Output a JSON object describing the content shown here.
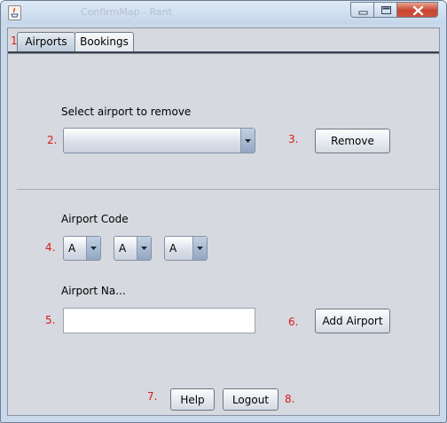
{
  "window": {
    "blurred_title": "ConfirmMap - Rant",
    "controls": [
      "minimize-icon",
      "maximize-icon",
      "close-icon"
    ]
  },
  "tabs": [
    {
      "label": "Airports",
      "selected": true
    },
    {
      "label": "Bookings",
      "selected": false
    }
  ],
  "annotations": {
    "n1": "1.",
    "n2": "2.",
    "n3": "3.",
    "n4": "4.",
    "n5": "5.",
    "n6": "6.",
    "n7": "7.",
    "n8": "8.",
    "color": "#d81b1b"
  },
  "remove_section": {
    "label": "Select airport to remove",
    "selected_value": "",
    "remove_button": "Remove"
  },
  "add_section": {
    "code_label": "Airport Code",
    "code_letters": [
      "A",
      "A",
      "A"
    ],
    "name_label": "Airport Na...",
    "name_value": "",
    "add_button": "Add Airport"
  },
  "footer": {
    "help_button": "Help",
    "logout_button": "Logout"
  },
  "colors": {
    "panel": "#d6d9df",
    "frame": "#c9d9ea",
    "close_button": "#c8452f"
  }
}
